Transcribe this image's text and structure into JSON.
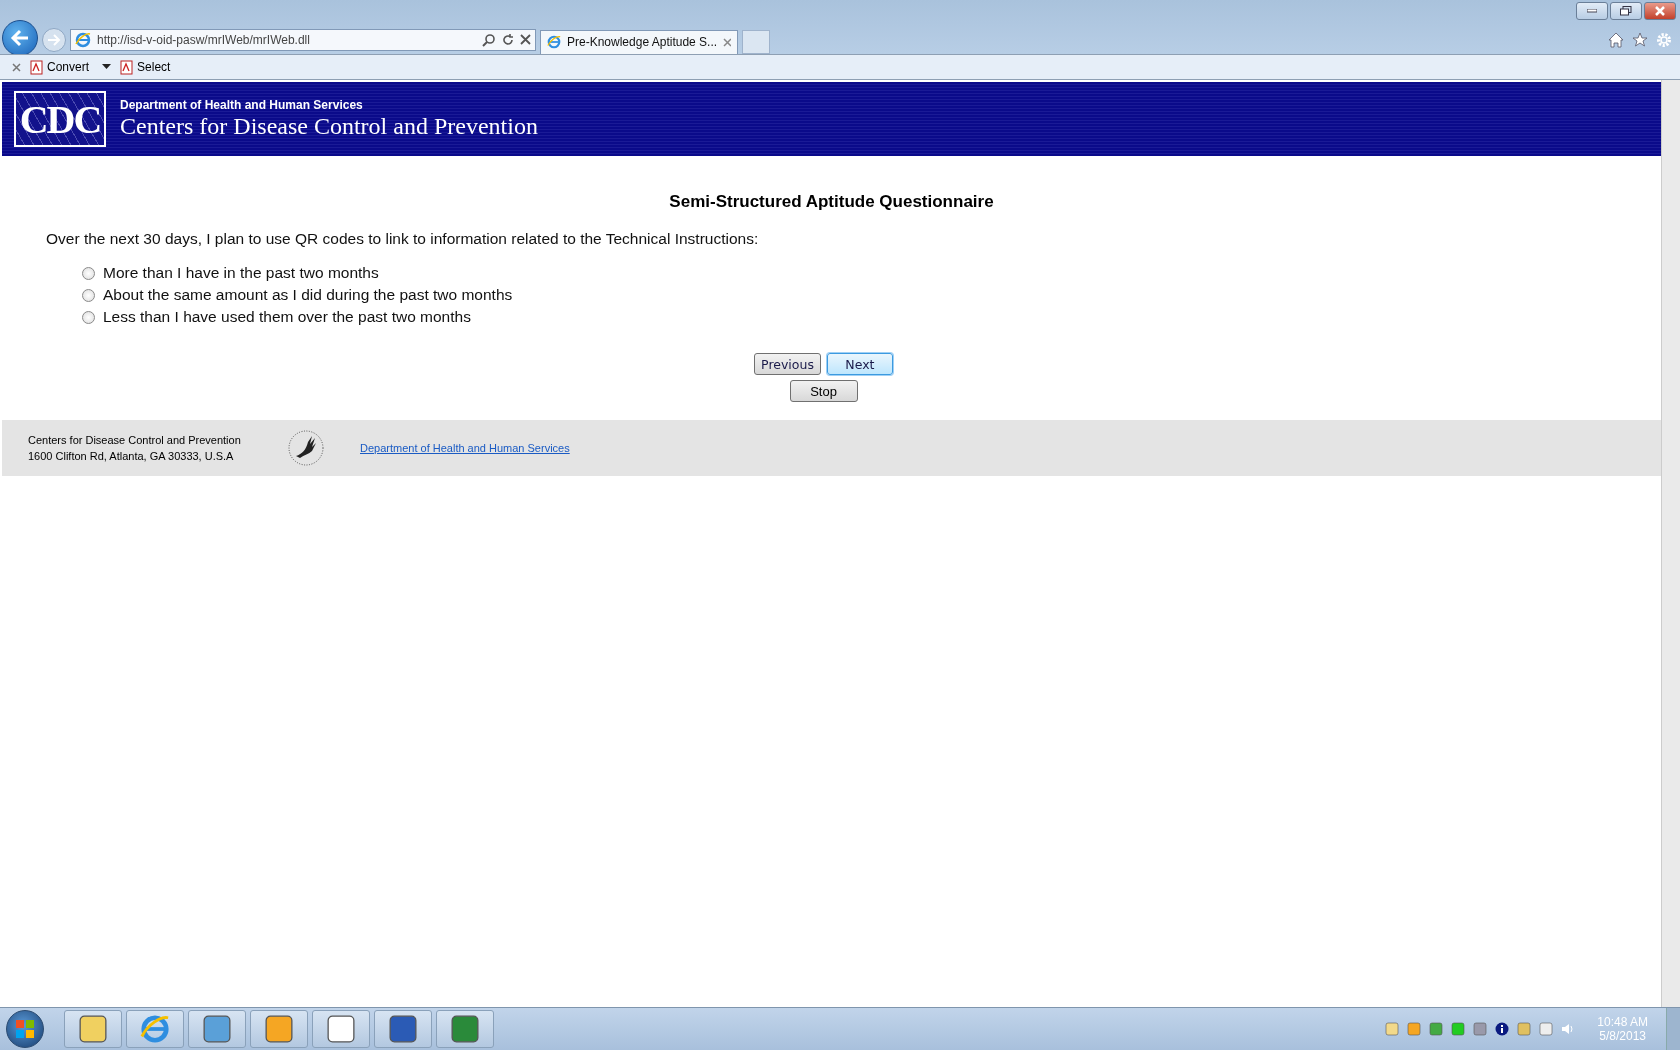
{
  "browser": {
    "address": "http://isd-v-oid-pasw/mrIWeb/mrIWeb.dll",
    "tab_title": "Pre-Knowledge Aptitude S...",
    "command_bar": [
      "Convert",
      "Select"
    ]
  },
  "site_header": {
    "logo": "CDC",
    "department": "Department of Health and Human Services",
    "agency": "Centers for Disease Control and Prevention"
  },
  "survey": {
    "title": "Semi-Structured Aptitude Questionnaire",
    "question": "Over the next 30 days, I plan to use QR codes to link to information related to the Technical Instructions:",
    "options": [
      {
        "label": "More than I have in the past two months",
        "selected": false
      },
      {
        "label": "About the same amount as I did during the past two months",
        "selected": false
      },
      {
        "label": "Less than I have used them over the past two months",
        "selected": false
      }
    ],
    "buttons": [
      {
        "label": "Previous",
        "focused": false
      },
      {
        "label": "Next",
        "focused": true
      }
    ],
    "stop_button": "Stop"
  },
  "footer": {
    "lines": [
      "Centers for Disease Control and Prevention",
      "1600 Clifton Rd, Atlanta, GA 30333, U.S.A"
    ],
    "link": "Department of Health and Human Services"
  },
  "taskbar": {
    "time": "10:48 AM",
    "date": "5/8/2013"
  }
}
